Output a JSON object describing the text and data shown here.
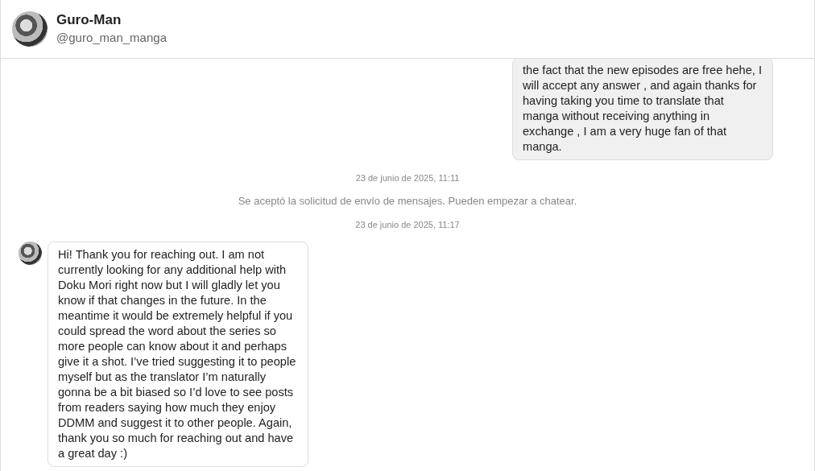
{
  "header": {
    "name": "Guro-Man",
    "handle": "@guro_man_manga"
  },
  "messages": [
    {
      "kind": "sent",
      "text": "the fact that the new episodes are free hehe, I will accept any answer , and again thanks for having taking you time to translate that manga without receiving anything in exchange , I am a very huge fan of that manga."
    },
    {
      "kind": "timestamp",
      "text": "23 de junio de 2025, 11:11"
    },
    {
      "kind": "system",
      "text": "Se aceptó la solicitud de envío de mensajes. Pueden empezar a chatear."
    },
    {
      "kind": "timestamp",
      "text": "23 de junio de 2025, 11:17"
    },
    {
      "kind": "received",
      "text": "Hi! Thank you for reaching out. I am not currently looking for any additional help with Doku Mori right now but I will gladly let you know if that changes in the future. In the meantime it would be extremely helpful if you could spread the word about the series so more people can know about it and perhaps give it a shot. I’ve tried suggesting it to people myself but as the translator I’m naturally gonna be a bit biased so I’d love to see posts from readers saying how much they enjoy DDMM and suggest it to other people. Again, thank you so much for reaching out and have a great day :)"
    }
  ]
}
